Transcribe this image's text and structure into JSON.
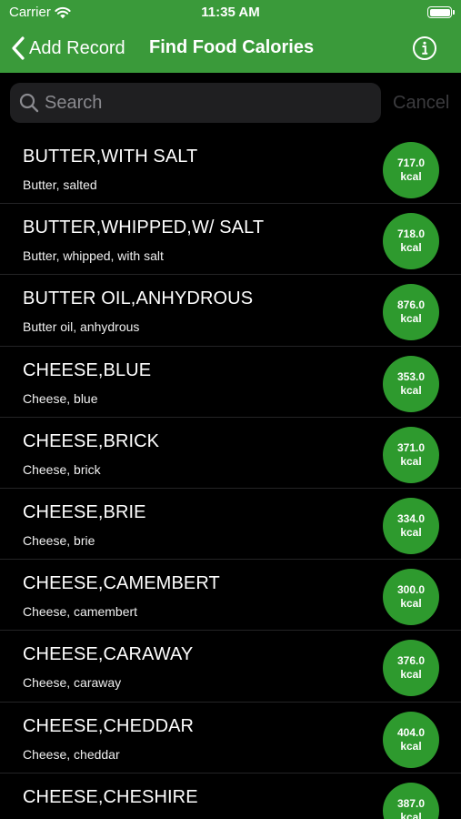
{
  "status": {
    "carrier": "Carrier",
    "time": "11:35 AM"
  },
  "nav": {
    "back_label": "Add Record",
    "title": "Find Food Calories"
  },
  "search": {
    "placeholder": "Search",
    "value": "",
    "cancel_label": "Cancel"
  },
  "colors": {
    "nav_background": "#3a9a3a",
    "badge_background": "#2e9a2e",
    "list_background": "#000000"
  },
  "foods": [
    {
      "name": "BUTTER,WITH SALT",
      "description": "Butter, salted",
      "calories": "717.0",
      "unit": "kcal"
    },
    {
      "name": "BUTTER,WHIPPED,W/ SALT",
      "description": "Butter, whipped, with salt",
      "calories": "718.0",
      "unit": "kcal"
    },
    {
      "name": "BUTTER OIL,ANHYDROUS",
      "description": "Butter oil, anhydrous",
      "calories": "876.0",
      "unit": "kcal"
    },
    {
      "name": "CHEESE,BLUE",
      "description": "Cheese, blue",
      "calories": "353.0",
      "unit": "kcal"
    },
    {
      "name": "CHEESE,BRICK",
      "description": "Cheese, brick",
      "calories": "371.0",
      "unit": "kcal"
    },
    {
      "name": "CHEESE,BRIE",
      "description": "Cheese, brie",
      "calories": "334.0",
      "unit": "kcal"
    },
    {
      "name": "CHEESE,CAMEMBERT",
      "description": "Cheese, camembert",
      "calories": "300.0",
      "unit": "kcal"
    },
    {
      "name": "CHEESE,CARAWAY",
      "description": "Cheese, caraway",
      "calories": "376.0",
      "unit": "kcal"
    },
    {
      "name": "CHEESE,CHEDDAR",
      "description": "Cheese, cheddar",
      "calories": "404.0",
      "unit": "kcal"
    },
    {
      "name": "CHEESE,CHESHIRE",
      "description": "",
      "calories": "387.0",
      "unit": "kcal"
    }
  ]
}
